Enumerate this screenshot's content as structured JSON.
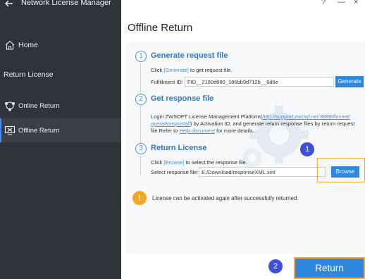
{
  "app": {
    "title": "Network License Manager"
  },
  "window": {
    "help_symbol": "?",
    "minimize_symbol": "—",
    "close_symbol": "×"
  },
  "sidebar": {
    "home_label": "Home",
    "return_license_label": "Return License",
    "online_return_label": "Online Return",
    "offline_return_label": "Offline Return"
  },
  "main": {
    "title": "Offline Return",
    "steps": [
      {
        "number": "1",
        "title": "Generate request file",
        "instruction_pre": "Click",
        "instruction_link": "[Generate]",
        "instruction_post": "to get request file.",
        "field_label": "Fulfillment ID:",
        "field_value": "FID__2180d680_186bb9d712b__6d6e",
        "button_label": "Generate"
      },
      {
        "number": "2",
        "title": "Get response file",
        "line1_pre": "Login ZWSOFT License Management Platform(",
        "link_url_part1": "http://support.zwcad.net:8888/flexnet/",
        "link_url_part2": "operationsportal/",
        "line2_post": ") by Activation ID, and generate return response files by return request",
        "line3_pre": "file.Refer to",
        "help_link": "Help document",
        "line3_post": "for more details."
      },
      {
        "number": "3",
        "title": "Return License",
        "instruction_pre": "Click",
        "instruction_link": "[Browse]",
        "instruction_post": "to select the response file.",
        "field_label": "Select response file:",
        "field_value": "E:/Download/responseXML.xml",
        "button_label": "Browse"
      }
    ],
    "notice": {
      "icon_text": "!",
      "text": "License can be activated again after successfully returned."
    },
    "badges": {
      "browse": "1",
      "return": "2"
    },
    "return_button_label": "Return"
  },
  "colors": {
    "sidebar_bg": "#2f3438",
    "accent": "#2e86de",
    "highlight": "#f4a940",
    "badge": "#3c4fe0",
    "warning": "#f6a623"
  }
}
